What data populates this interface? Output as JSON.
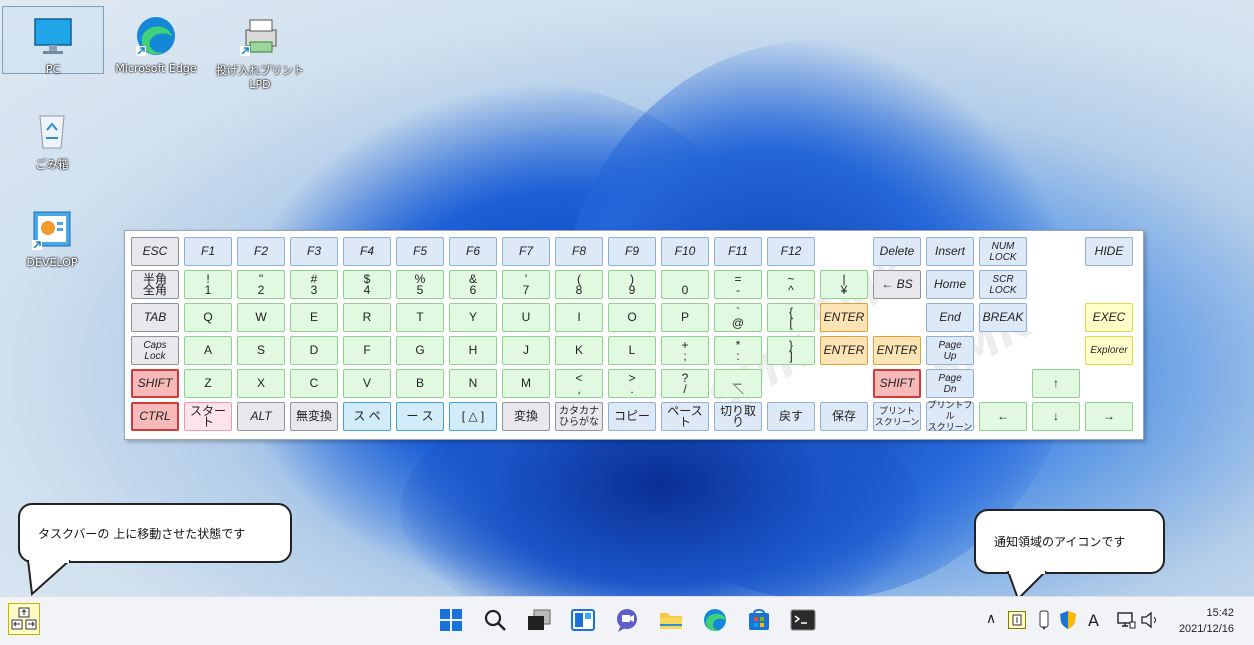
{
  "desktop": {
    "icons": [
      {
        "label": "PC"
      },
      {
        "label": "Microsoft Edge"
      },
      {
        "label": "投げ入れプリントLPD"
      },
      {
        "label": "ごみ箱"
      },
      {
        "label": "DEVELOP"
      }
    ]
  },
  "keyboard": {
    "watermark": "SMK",
    "rows": [
      [
        [
          "ESC",
          "gray"
        ],
        [
          "F1",
          "blue"
        ],
        [
          "F2",
          "blue"
        ],
        [
          "F3",
          "blue"
        ],
        [
          "F4",
          "blue"
        ],
        [
          "F5",
          "blue"
        ],
        [
          "F6",
          "blue"
        ],
        [
          "F7",
          "blue"
        ],
        [
          "F8",
          "blue"
        ],
        [
          "F9",
          "blue"
        ],
        [
          "F10",
          "blue"
        ],
        [
          "F11",
          "blue"
        ],
        [
          "F12",
          "blue"
        ]
      ],
      [
        [
          "半角\n全角",
          "gray"
        ],
        [
          "!\n1",
          "green"
        ],
        [
          "\"\n2",
          "green"
        ],
        [
          "#\n3",
          "green"
        ],
        [
          "$\n4",
          "green"
        ],
        [
          "%\n5",
          "green"
        ],
        [
          "&\n6",
          "green"
        ],
        [
          "'\n7",
          "green"
        ],
        [
          "(\n8",
          "green"
        ],
        [
          ")\n9",
          "green"
        ],
        [
          "\n0",
          "green"
        ],
        [
          "=\n-",
          "green"
        ],
        [
          "~\n^",
          "green"
        ],
        [
          "|\n¥",
          "green"
        ]
      ],
      [
        [
          "TAB",
          "gray"
        ],
        [
          "Q",
          "green"
        ],
        [
          "W",
          "green"
        ],
        [
          "E",
          "green"
        ],
        [
          "R",
          "green"
        ],
        [
          "T",
          "green"
        ],
        [
          "Y",
          "green"
        ],
        [
          "U",
          "green"
        ],
        [
          "I",
          "green"
        ],
        [
          "O",
          "green"
        ],
        [
          "P",
          "green"
        ],
        [
          "`\n@",
          "green"
        ],
        [
          "{\n[",
          "green"
        ],
        [
          "ENTER",
          "orange"
        ]
      ],
      [
        [
          "Caps\nLock",
          "gray"
        ],
        [
          "A",
          "green"
        ],
        [
          "S",
          "green"
        ],
        [
          "D",
          "green"
        ],
        [
          "F",
          "green"
        ],
        [
          "G",
          "green"
        ],
        [
          "H",
          "green"
        ],
        [
          "J",
          "green"
        ],
        [
          "K",
          "green"
        ],
        [
          "L",
          "green"
        ],
        [
          "+\n;",
          "green"
        ],
        [
          "*\n:",
          "green"
        ],
        [
          "}\n]",
          "green"
        ],
        [
          "ENTER",
          "orange"
        ]
      ],
      [
        [
          "SHIFT",
          "red"
        ],
        [
          "Z",
          "green"
        ],
        [
          "X",
          "green"
        ],
        [
          "C",
          "green"
        ],
        [
          "V",
          "green"
        ],
        [
          "B",
          "green"
        ],
        [
          "N",
          "green"
        ],
        [
          "M",
          "green"
        ],
        [
          "<\n,",
          "green"
        ],
        [
          ">\n.",
          "green"
        ],
        [
          "?\n/",
          "green"
        ],
        [
          "_\n＼",
          "green"
        ]
      ],
      [
        [
          "CTRL",
          "red"
        ],
        [
          "スタート",
          "pink"
        ],
        [
          "ALT",
          "gray"
        ],
        [
          "無変換",
          "gray"
        ],
        [
          "ス ペ",
          "lblue"
        ],
        [
          "ー ス",
          "lblue"
        ],
        [
          "[ △ ]",
          "lblue"
        ],
        [
          "変換",
          "gray"
        ],
        [
          "カタカナ\nひらがな",
          "gray"
        ],
        [
          "コピー",
          "blue"
        ],
        [
          "ペースト",
          "blue"
        ],
        [
          "切り取り",
          "blue"
        ],
        [
          "戻す",
          "blue"
        ],
        [
          "保存",
          "blue"
        ],
        [
          "プリント\nスクリーン",
          "blue"
        ],
        [
          "プリントフル\nスクリーン",
          "blue"
        ]
      ]
    ],
    "right_block": [
      [
        "Delete",
        "blue"
      ],
      [
        "Insert",
        "blue"
      ],
      [
        "NUM\nLOCK",
        "blue"
      ],
      [
        "HIDE",
        "blue"
      ],
      [
        "← BS",
        "gray"
      ],
      [
        "Home",
        "blue"
      ],
      [
        "SCR\nLOCK",
        "blue"
      ],
      [
        "ENTER",
        "orange"
      ],
      [
        "End",
        "blue"
      ],
      [
        "BREAK",
        "blue"
      ],
      [
        "EXEC",
        "yellow"
      ],
      [
        "ENTER",
        "orange"
      ],
      [
        "Page\nUp",
        "blue"
      ],
      [
        "Explorer",
        "yellow"
      ],
      [
        "SHIFT",
        "red"
      ],
      [
        "Page\nDn",
        "blue"
      ],
      [
        "↑",
        "green"
      ],
      [
        "←",
        "green"
      ],
      [
        "↓",
        "green"
      ],
      [
        "→",
        "green"
      ]
    ]
  },
  "callouts": {
    "left": "タスクバーの 上に移動させた状態です",
    "right": "通知領域のアイコンです"
  },
  "taskbar": {
    "icons": [
      "start-icon",
      "search-icon",
      "task-view-icon",
      "widgets-icon",
      "chat-icon",
      "file-explorer-icon",
      "edge-icon",
      "store-icon",
      "terminal-icon"
    ],
    "tray": {
      "chevron": "∧",
      "ime": "A"
    },
    "clock": {
      "time": "15:42",
      "date": "2021/12/16"
    }
  }
}
